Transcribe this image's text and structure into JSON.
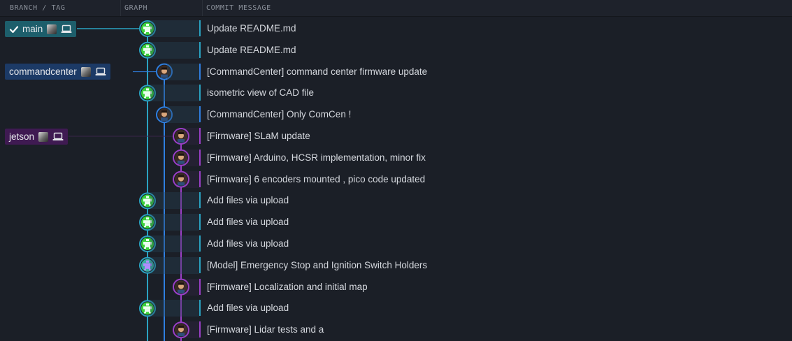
{
  "header": {
    "col_branch": "BRANCH / TAG",
    "col_graph": "GRAPH",
    "col_message": "COMMIT MESSAGE"
  },
  "branches": [
    {
      "name": "main",
      "color": "#1d5e6b",
      "checked_out": true
    },
    {
      "name": "commandcenter",
      "color": "#1c3a66",
      "checked_out": false
    },
    {
      "name": "jetson",
      "color": "#3f1a52",
      "checked_out": false
    }
  ],
  "lane_colors": [
    "#2aa3c2",
    "#2f7fe0",
    "#9b3fc7"
  ],
  "commits": [
    {
      "message": "Update README.md",
      "lane": 0,
      "avatar": "green-robot-icon"
    },
    {
      "message": "Update README.md",
      "lane": 0,
      "avatar": "green-robot-icon"
    },
    {
      "message": "[CommandCenter] command center firmware update",
      "lane": 1,
      "avatar": "person-photo-icon"
    },
    {
      "message": "isometric view of CAD file",
      "lane": 0,
      "avatar": "green-robot-icon"
    },
    {
      "message": "[CommandCenter] Only ComCen !",
      "lane": 1,
      "avatar": "person-photo-icon"
    },
    {
      "message": "[Firmware] SLaM update",
      "lane": 2,
      "avatar": "person-photo-icon"
    },
    {
      "message": "[Firmware] Arduino, HCSR implementation, minor fix",
      "lane": 2,
      "avatar": "person-photo-icon"
    },
    {
      "message": "[Firmware] 6 encoders mounted , pico code updated",
      "lane": 2,
      "avatar": "person-photo-icon"
    },
    {
      "message": "Add files via upload",
      "lane": 0,
      "avatar": "green-robot-icon"
    },
    {
      "message": "Add files via upload",
      "lane": 0,
      "avatar": "green-robot-icon"
    },
    {
      "message": "Add files via upload",
      "lane": 0,
      "avatar": "green-robot-icon"
    },
    {
      "message": "[Model] Emergency Stop and Ignition Switch Holders",
      "lane": 0,
      "avatar": "purple-robot-icon"
    },
    {
      "message": "[Firmware] Localization and initial map",
      "lane": 2,
      "avatar": "person-photo-icon"
    },
    {
      "message": "Add files via upload",
      "lane": 0,
      "avatar": "green-robot-icon"
    },
    {
      "message": "[Firmware] Lidar tests and a",
      "lane": 2,
      "avatar": "person-photo-icon"
    }
  ]
}
